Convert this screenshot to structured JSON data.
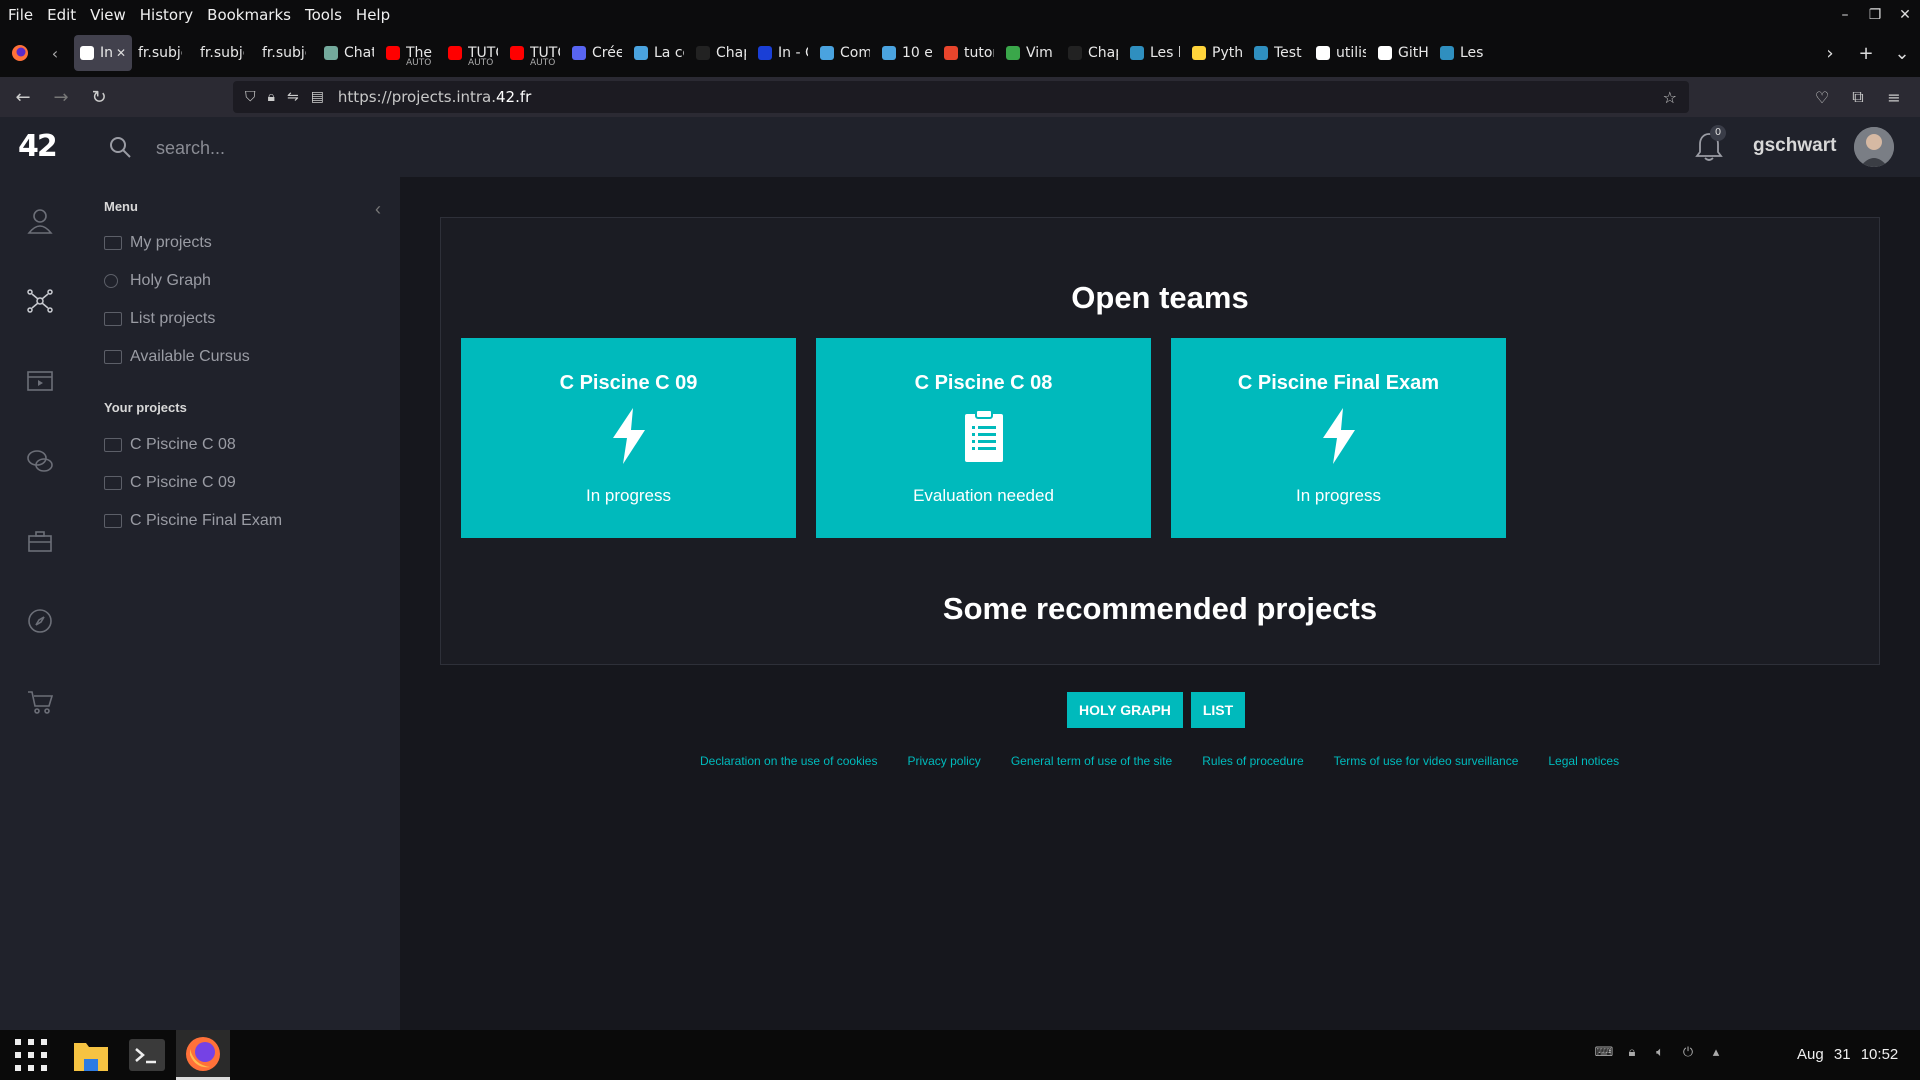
{
  "browser": {
    "menu": [
      "File",
      "Edit",
      "View",
      "History",
      "Bookmarks",
      "Tools",
      "Help"
    ],
    "tabs": [
      {
        "title": "Int",
        "active": true,
        "color": "#ffffff"
      },
      {
        "title": "fr.subje",
        "color": "#0c0c0d"
      },
      {
        "title": "fr.subje",
        "color": "#0c0c0d"
      },
      {
        "title": "fr.subje",
        "color": "#0c0c0d"
      },
      {
        "title": "Chat",
        "color": "#74aa9c"
      },
      {
        "title": "The C",
        "sub": "AUTO",
        "color": "#ff0000"
      },
      {
        "title": "TUTO",
        "sub": "AUTO",
        "color": "#ff0000"
      },
      {
        "title": "TUTO",
        "sub": "AUTO",
        "color": "#ff0000"
      },
      {
        "title": "Crée",
        "color": "#5865f2"
      },
      {
        "title": "La co",
        "color": "#4aa3df"
      },
      {
        "title": "Chap",
        "color": "#222222"
      },
      {
        "title": "In - C",
        "color": "#1a3fd6"
      },
      {
        "title": "Com",
        "color": "#4aa3df"
      },
      {
        "title": "10 e",
        "color": "#4aa3df"
      },
      {
        "title": "tutor",
        "color": "#e8452c"
      },
      {
        "title": "Vim",
        "color": "#3aa74a"
      },
      {
        "title": "Chap",
        "color": "#222222"
      },
      {
        "title": "Les b",
        "color": "#2f8fbf"
      },
      {
        "title": "Pyth",
        "color": "#ffd43b"
      },
      {
        "title": "Test",
        "color": "#2f8fbf"
      },
      {
        "title": "utilis",
        "color": "#ffffff"
      },
      {
        "title": "GitH",
        "color": "#ffffff"
      },
      {
        "title": "Les",
        "color": "#2f8fbf"
      }
    ],
    "url_prefix": "https://projects.intra.",
    "url_domain": "42.fr"
  },
  "topbar": {
    "logo": "42",
    "search_placeholder": "search...",
    "notifications_count": "0",
    "username": "gschwart"
  },
  "sidebar": {
    "menu_header": "Menu",
    "menu_items": [
      {
        "label": "My projects"
      },
      {
        "label": "Holy Graph"
      },
      {
        "label": "List projects"
      },
      {
        "label": "Available Cursus"
      }
    ],
    "projects_header": "Your projects",
    "project_items": [
      {
        "label": "C Piscine C 08"
      },
      {
        "label": "C Piscine C 09"
      },
      {
        "label": "C Piscine Final Exam"
      }
    ]
  },
  "main": {
    "open_teams_title": "Open teams",
    "teams": [
      {
        "name": "C Piscine C 09",
        "status": "In progress",
        "icon": "lightning-icon"
      },
      {
        "name": "C Piscine C 08",
        "status": "Evaluation needed",
        "icon": "clipboard-icon"
      },
      {
        "name": "C Piscine Final Exam",
        "status": "In progress",
        "icon": "lightning-icon"
      }
    ],
    "recommended_title": "Some recommended projects",
    "buttons": {
      "holy_graph": "HOLY GRAPH",
      "list": "LIST"
    },
    "accent_color": "#00babc"
  },
  "footer": {
    "links": [
      "Declaration on the use of cookies",
      "Privacy policy",
      "General term of use of the site",
      "Rules of procedure",
      "Terms of use for video surveillance",
      "Legal notices"
    ]
  },
  "taskbar": {
    "date": "Aug 31",
    "time": "10:52"
  }
}
